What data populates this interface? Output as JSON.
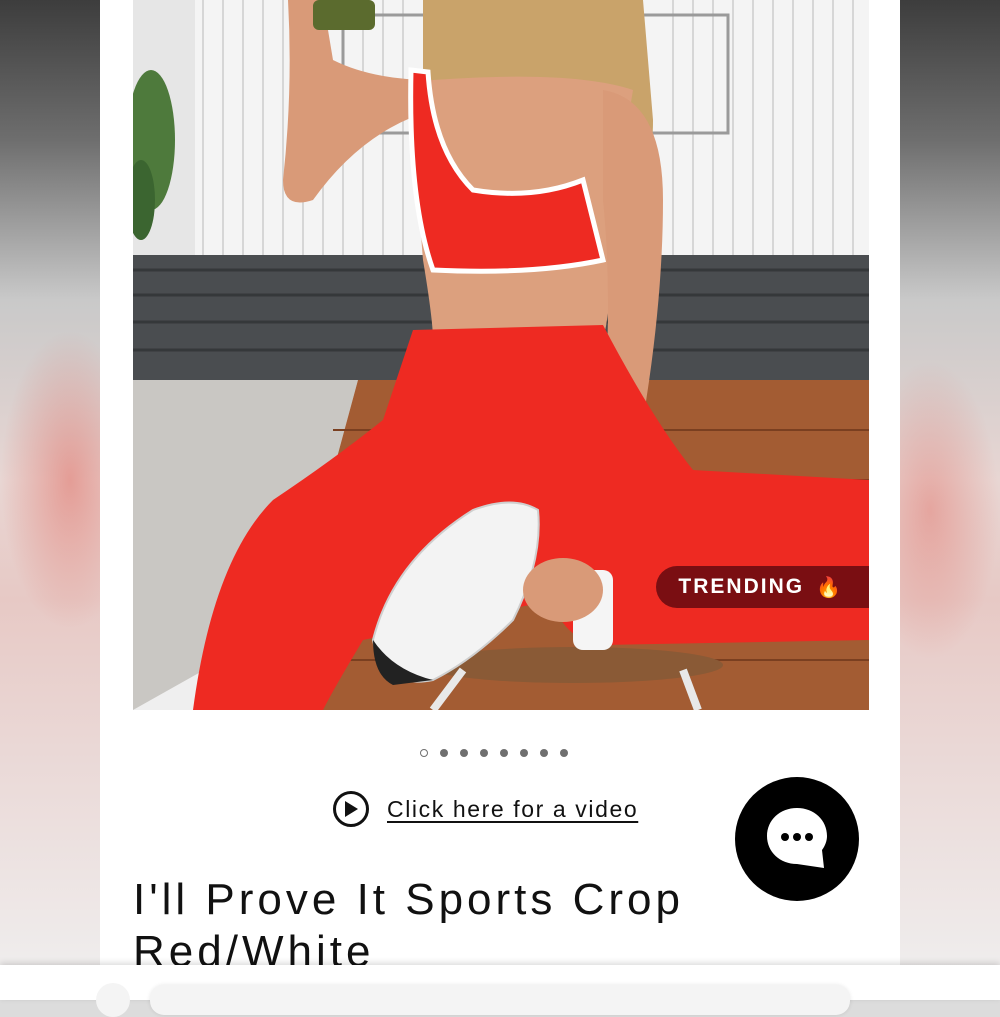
{
  "product": {
    "title_line1": "I'll Prove It Sports Crop",
    "title_line2": "Red/White",
    "badge": "TRENDING",
    "badge_icon": "fire-icon"
  },
  "gallery": {
    "total_images": 8,
    "active_index": 0
  },
  "video": {
    "link_text": "Click here for a video",
    "icon": "play-circle-icon"
  },
  "chat": {
    "icon": "chat-bubble-icon"
  },
  "colors": {
    "badge_bg": "#7a0e12",
    "outfit_red": "#ee2a22",
    "chat_bg": "#000000"
  }
}
